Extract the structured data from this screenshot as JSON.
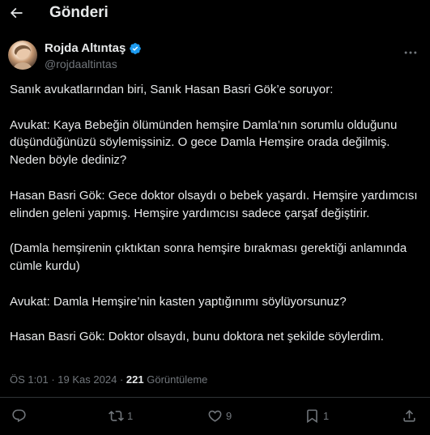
{
  "header": {
    "title": "Gönderi",
    "back_icon": "arrow-left-icon"
  },
  "author": {
    "name": "Rojda Altıntaş",
    "handle": "@rojdaaltintas",
    "verified_color": "#1d9bf0"
  },
  "post": {
    "paragraphs": [
      "Sanık avukatlarından biri, Sanık Hasan Basri Gök’e soruyor:",
      "Avukat: Kaya Bebeğin ölümünden hemşire Damla’nın sorumlu olduğunu düşündüğünüzü söylemişsiniz. O gece Damla Hemşire orada değilmiş. Neden böyle dediniz?",
      "Hasan Basri Gök: Gece doktor olsaydı o bebek yaşardı. Hemşire yardımcısı elinden geleni yapmış. Hemşire yardımcısı sadece çarşaf değiştirir.",
      "(Damla hemşirenin çıktıktan sonra hemşire bırakması gerektiği anlamında cümle kurdu)",
      "Avukat: Damla Hemşire’nin kasten yaptığınımı söylüyorsunuz?",
      "Hasan Basri Gök: Doktor olsaydı, bunu doktora net şekilde söylerdim."
    ]
  },
  "meta": {
    "time": "ÖS 1:01",
    "date": "19 Kas 2024",
    "views": "221",
    "views_label": "Görüntüleme",
    "sep": "·"
  },
  "actions": {
    "reply_count": "",
    "repost_count": "1",
    "like_count": "9",
    "bookmark_count": "1"
  }
}
